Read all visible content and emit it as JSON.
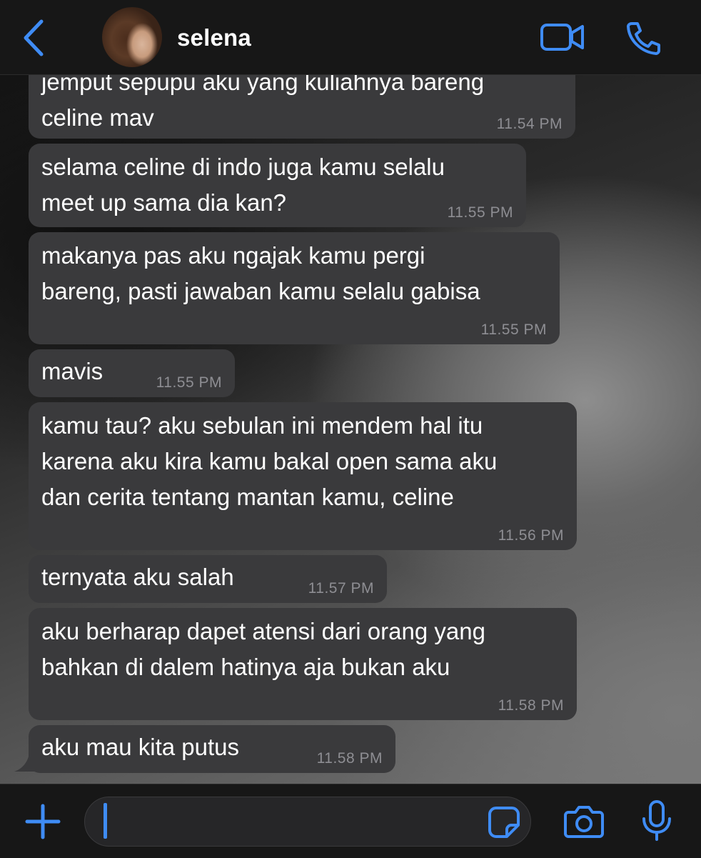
{
  "header": {
    "contact_name": "selena",
    "back_icon": "chevron-left-icon",
    "video_icon": "video-camera-icon",
    "call_icon": "phone-icon",
    "accent_color": "#3f8cf5"
  },
  "messages": [
    {
      "text": "jemput sepupu aku yang kuliahnya bareng\nceline mav",
      "time": "11.54 PM"
    },
    {
      "text": "selama celine di indo juga kamu selalu\nmeet up sama dia kan?",
      "time": "11.55 PM"
    },
    {
      "text": "makanya pas aku ngajak kamu pergi\nbareng, pasti jawaban kamu selalu gabisa",
      "time": "11.55 PM"
    },
    {
      "text": "mavis",
      "time": "11.55 PM"
    },
    {
      "text": "kamu tau? aku sebulan ini mendem hal itu\nkarena aku kira kamu bakal open sama aku\ndan cerita tentang mantan kamu, celine",
      "time": "11.56 PM"
    },
    {
      "text": "ternyata aku salah",
      "time": "11.57 PM"
    },
    {
      "text": "aku berharap dapet atensi dari orang yang\nbahkan di dalem hatinya aja bukan aku",
      "time": "11.58 PM"
    },
    {
      "text": "aku mau kita putus",
      "time": "11.58 PM"
    }
  ],
  "composer": {
    "plus_icon": "plus-icon",
    "sticker_icon": "sticker-icon",
    "camera_icon": "camera-icon",
    "mic_icon": "microphone-icon",
    "input_value": ""
  }
}
